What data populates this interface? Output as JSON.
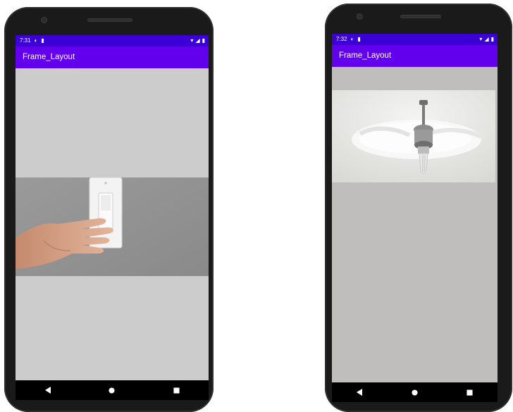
{
  "screens": [
    {
      "id": "switch-screen",
      "status_time": "7:31",
      "app_title": "Frame_Layout",
      "image": "light-switch"
    },
    {
      "id": "fan-screen",
      "status_time": "7:32",
      "app_title": "Frame_Layout",
      "image": "ceiling-fan"
    }
  ],
  "colors": {
    "statusbar": "#3a00d6",
    "appbar": "#6200ee",
    "navbar": "#000000",
    "content_left": "#cccccc",
    "content_right": "#c0bdbd"
  }
}
